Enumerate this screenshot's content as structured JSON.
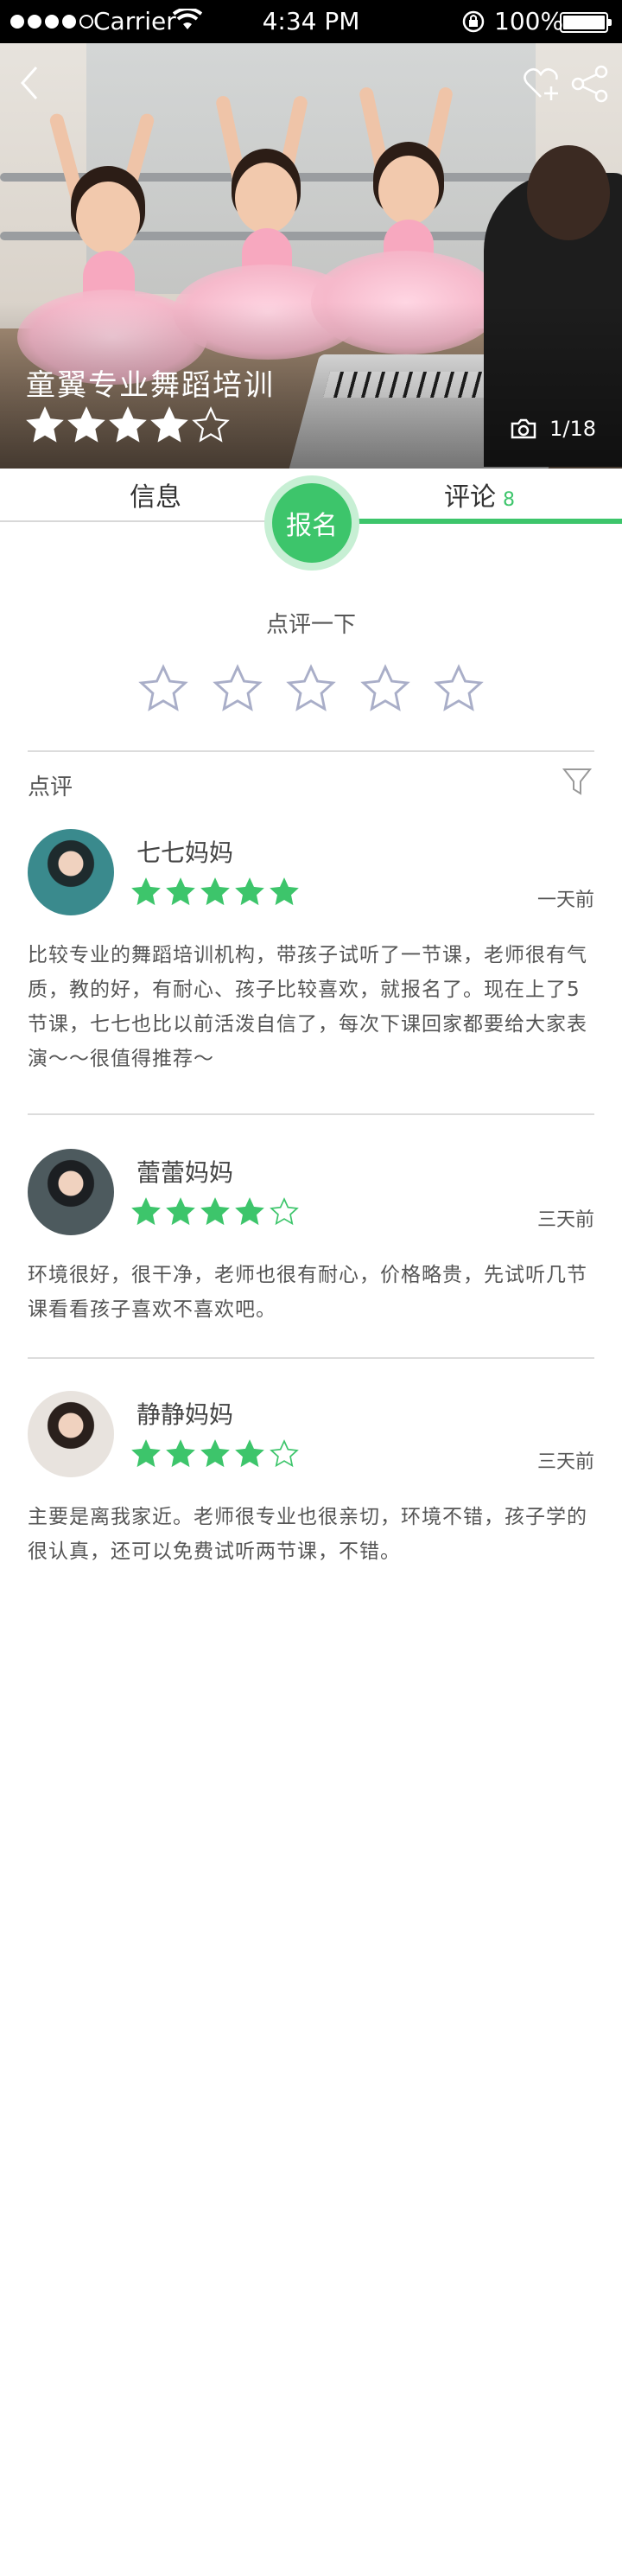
{
  "status_bar": {
    "carrier": "Carrier",
    "time": "4:34 PM",
    "battery": "100%"
  },
  "hero": {
    "title": "童翼专业舞蹈培训",
    "rating": 4,
    "rating_max": 5,
    "photo_counter": "1/18"
  },
  "tabs": {
    "info_label": "信息",
    "review_label": "评论",
    "review_count": "8",
    "enroll_label": "报名"
  },
  "rate": {
    "title": "点评一下",
    "stars": 5
  },
  "reviews_section": {
    "header": "点评"
  },
  "reviews": [
    {
      "name": "七七妈妈",
      "stars": 5,
      "time": "一天前",
      "text": "比较专业的舞蹈培训机构，带孩子试听了一节课，老师很有气质，教的好，有耐心、孩子比较喜欢，就报名了。现在上了5节课，七七也比以前活泼自信了，每次下课回家都要给大家表演～～很值得推荐～"
    },
    {
      "name": "蕾蕾妈妈",
      "stars": 4,
      "time": "三天前",
      "text": "环境很好，很干净，老师也很有耐心，价格略贵，先试听几节课看看孩子喜欢不喜欢吧。"
    },
    {
      "name": "静静妈妈",
      "stars": 4,
      "time": "三天前",
      "text": "主要是离我家近。老师很专业也很亲切，环境不错，孩子学的很认真，还可以免费试听两节课，不错。"
    }
  ],
  "colors": {
    "accent": "#3dc56b",
    "accent_light": "#c7efd4",
    "status_bar_bg": "#000000"
  },
  "icons": {
    "back": "chevron-left-icon",
    "favorite": "heart-plus-icon",
    "share": "share-icon",
    "camera": "camera-icon",
    "filter": "filter-icon",
    "star": "star-icon"
  }
}
